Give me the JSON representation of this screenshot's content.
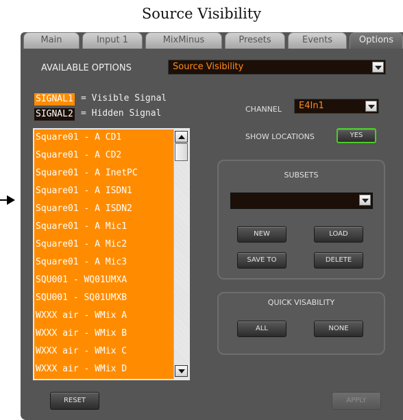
{
  "caption": "Source Visibility",
  "tabs": [
    {
      "label": "Main"
    },
    {
      "label": "Input 1"
    },
    {
      "label": "MixMinus"
    },
    {
      "label": "Presets"
    },
    {
      "label": "Events"
    },
    {
      "label": "Options",
      "active": true
    }
  ],
  "available_options": {
    "label": "AVAILABLE OPTIONS",
    "value": "Source Visibility"
  },
  "legend": {
    "visible_swatch": "SIGNAL1",
    "visible_text": "= Visible Signal",
    "hidden_swatch": "SIGNAL2",
    "hidden_text": "= Hidden Signal",
    "visible_color": "#ff8c00",
    "hidden_color": "#1c0f08"
  },
  "channel": {
    "label": "CHANNEL",
    "value": "E4In1"
  },
  "show_locations": {
    "label": "SHOW LOCATIONS",
    "button": "YES"
  },
  "sources": [
    "Square01 - A CD1",
    "Square01 - A CD2",
    "Square01 - A InetPC",
    "Square01 - A ISDN1",
    "Square01 - A ISDN2",
    "Square01 - A Mic1",
    "Square01 - A Mic2",
    "Square01 - A Mic3",
    "SQU001 - WQ01UMXA",
    "SQU001 - SQ01UMXB",
    "WXXX air - WMix A",
    "WXXX air - WMix B",
    "WXXX air - WMix C",
    "WXXX air - WMix D"
  ],
  "subsets": {
    "title": "SUBSETS",
    "selected": "",
    "new": "NEW",
    "load": "LOAD",
    "save_to": "SAVE TO",
    "delete": "DELETE"
  },
  "quick_visibility": {
    "title": "QUICK VISABILITY",
    "all": "ALL",
    "none": "NONE"
  },
  "reset": "RESET",
  "apply": "APPLY",
  "colors": {
    "accent_orange": "#ff8c00",
    "panel_bg": "#555555",
    "highlight_green": "#4dcb2c"
  }
}
